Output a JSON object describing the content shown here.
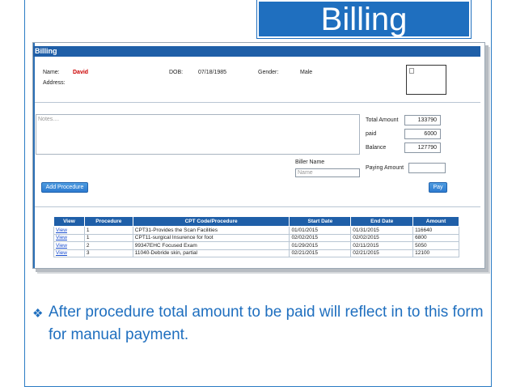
{
  "slide": {
    "title": "Billing",
    "bullet_text": "After procedure total amount to be paid will reflect in to this form for manual payment."
  },
  "form": {
    "header_title": "Billing",
    "patient": {
      "name_label": "Name:",
      "name_value": "David",
      "address_label": "Address:",
      "dob_label": "DOB:",
      "dob_value": "07/18/1985",
      "gender_label": "Gender:",
      "gender_value": "Male"
    },
    "notes_placeholder": "Notes....",
    "totals": {
      "total_amount_label": "Total Amount",
      "total_amount_value": "133790",
      "paid_label": "paid",
      "paid_value": "6000",
      "balance_label": "Balance",
      "balance_value": "127790"
    },
    "biller_name_label": "Biller Name",
    "biller_name_placeholder": "Name",
    "paying_amount_label": "Paying Amount",
    "add_procedure_button": "Add Procedure",
    "pay_button": "Pay",
    "table": {
      "headers": [
        "View",
        "Procedure",
        "CPT Code/Procedure",
        "Start Date",
        "End Date",
        "Amount"
      ],
      "rows": [
        [
          "View",
          "1",
          "CPT31-Provides the Scan Facilities",
          "01/01/2015",
          "01/31/2015",
          "116640"
        ],
        [
          "View",
          "1",
          "CPT11-surgical Insurence for foot",
          "02/02/2015",
          "02/02/2015",
          "6800"
        ],
        [
          "View",
          "2",
          "99347EHC Focused Exam",
          "01/29/2015",
          "02/11/2015",
          "5050"
        ],
        [
          "View",
          "3",
          "11040-Debride skin, partial",
          "02/21/2015",
          "02/21/2015",
          "12100"
        ]
      ]
    }
  }
}
